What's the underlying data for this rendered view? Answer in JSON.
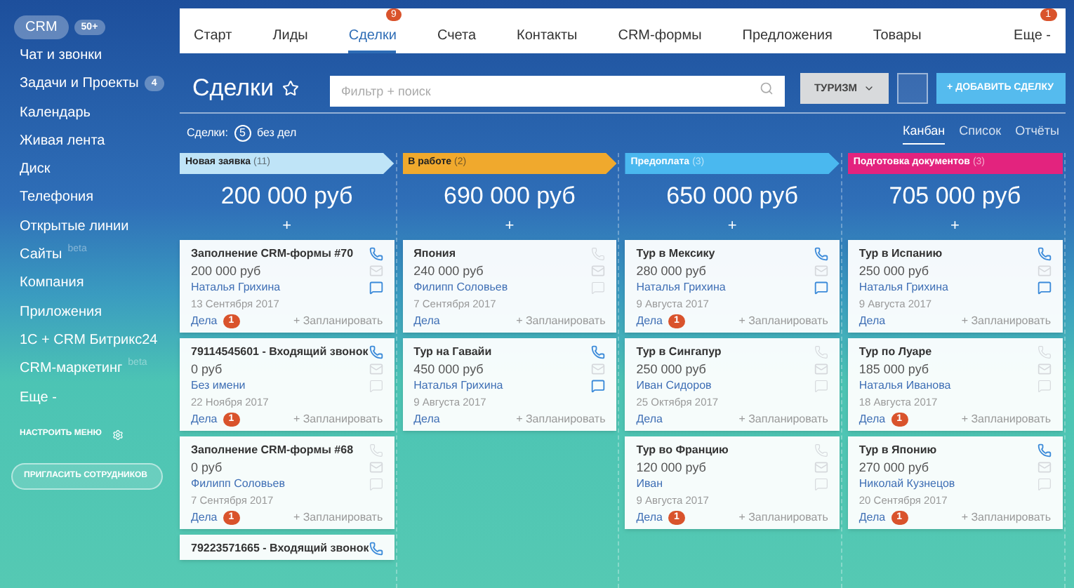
{
  "sidebar": {
    "items": [
      {
        "label": "CRM",
        "selected": true,
        "badge": "50+"
      },
      {
        "label": "Чат и звонки",
        "selected": false
      },
      {
        "label": "Задачи и Проекты",
        "selected": false,
        "badge": "4"
      },
      {
        "label": "Календарь",
        "selected": false
      },
      {
        "label": "Живая лента",
        "selected": false
      },
      {
        "label": "Диск",
        "selected": false
      },
      {
        "label": "Телефония",
        "selected": false
      },
      {
        "label": "Открытые линии",
        "selected": false
      },
      {
        "label": "Сайты",
        "selected": false,
        "tag": "beta"
      },
      {
        "label": "Компания",
        "selected": false
      },
      {
        "label": "Приложения",
        "selected": false
      },
      {
        "label": "1С + CRM Битрикс24",
        "selected": false
      },
      {
        "label": "CRM-маркетинг",
        "selected": false,
        "tag": "beta"
      },
      {
        "label": "Еще -",
        "selected": false
      }
    ],
    "settings": "НАСТРОИТЬ МЕНЮ",
    "invite": "ПРИГЛАСИТЬ СОТРУДНИКОВ"
  },
  "tabs": [
    {
      "label": "Старт",
      "selected": false
    },
    {
      "label": "Лиды",
      "selected": false
    },
    {
      "label": "Сделки",
      "selected": true,
      "badge": "9"
    },
    {
      "label": "Счета",
      "selected": false
    },
    {
      "label": "Контакты",
      "selected": false
    },
    {
      "label": "CRM-формы",
      "selected": false
    },
    {
      "label": "Предложения",
      "selected": false
    },
    {
      "label": "Товары",
      "selected": false
    },
    {
      "label": "Еще -",
      "selected": false,
      "badge": "1"
    }
  ],
  "page": {
    "title": "Сделки",
    "search": {
      "placeholder": "Фильтр + поиск"
    },
    "category": "ТУРИЗМ",
    "add_button": "+ ДОБАВИТЬ СДЕЛКУ"
  },
  "summary": {
    "label": "Сделки:",
    "count": "5",
    "suffix": "без дел"
  },
  "views": [
    {
      "label": "Канбан",
      "selected": true
    },
    {
      "label": "Список",
      "selected": false
    },
    {
      "label": "Отчёты",
      "selected": false
    }
  ],
  "columns": [
    {
      "title": "Новая заявка",
      "count": "(11)",
      "color": "#bfe4f7",
      "total": "200 000 руб",
      "plus": "+",
      "cards": [
        {
          "title": "Заполнение CRM-формы #70",
          "amount": "200 000 руб",
          "contact": "Наталья Грихина",
          "date": "13 Сентября 2017",
          "tasks": "Дела",
          "tasks_count": "1",
          "plan": "+ Запланировать",
          "phone_active": true,
          "chat_active": true
        },
        {
          "title": "79114545601 - Входящий звонок",
          "amount": "0 руб",
          "contact": "Без имени",
          "date": "22 Ноября 2017",
          "tasks": "Дела",
          "tasks_count": "1",
          "plan": "+ Запланировать",
          "phone_active": true,
          "chat_active": false
        },
        {
          "title": "Заполнение CRM-формы #68",
          "amount": "0 руб",
          "contact": "Филипп Соловьев",
          "date": "7 Сентября 2017",
          "tasks": "Дела",
          "tasks_count": "1",
          "plan": "+ Запланировать",
          "phone_active": false,
          "chat_active": false
        },
        {
          "title": "79223571665 - Входящий звонок",
          "phone_active": true
        }
      ]
    },
    {
      "title": "В работе",
      "count": "(2)",
      "color": "#f0a92d",
      "total": "690 000 руб",
      "plus": "+",
      "cards": [
        {
          "title": "Япония",
          "amount": "240 000 руб",
          "contact": "Филипп Соловьев",
          "date": "7 Сентября 2017",
          "tasks": "Дела",
          "plan": "+ Запланировать",
          "phone_active": false,
          "chat_active": false
        },
        {
          "title": "Тур на Гавайи",
          "amount": "450 000 руб",
          "contact": "Наталья Грихина",
          "date": "9 Августа 2017",
          "tasks": "Дела",
          "plan": "+ Запланировать",
          "phone_active": true,
          "chat_active": true
        }
      ]
    },
    {
      "title": "Предоплата",
      "count": "(3)",
      "color": "#4ab8ef",
      "total": "650 000 руб",
      "plus": "+",
      "cards": [
        {
          "title": "Тур в Мексику",
          "amount": "280 000 руб",
          "contact": "Наталья Грихина",
          "date": "9 Августа 2017",
          "tasks": "Дела",
          "tasks_count": "1",
          "plan": "+ Запланировать",
          "phone_active": true,
          "chat_active": true
        },
        {
          "title": "Тур в Сингапур",
          "amount": "250 000 руб",
          "contact": "Иван Сидоров",
          "date": "25 Октября 2017",
          "tasks": "Дела",
          "plan": "+ Запланировать",
          "phone_active": false,
          "chat_active": false
        },
        {
          "title": "Тур во Францию",
          "amount": "120 000 руб",
          "contact": "Иван",
          "date": "9 Августа 2017",
          "tasks": "Дела",
          "tasks_count": "1",
          "plan": "+ Запланировать",
          "phone_active": false,
          "chat_active": false
        }
      ]
    },
    {
      "title": "Подготовка документов",
      "count": "(3)",
      "color": "#e3237e",
      "total": "705 000 руб",
      "plus": "+",
      "cards": [
        {
          "title": "Тур в Испанию",
          "amount": "250 000 руб",
          "contact": "Наталья Грихина",
          "date": "9 Августа 2017",
          "tasks": "Дела",
          "plan": "+ Запланировать",
          "phone_active": true,
          "chat_active": true
        },
        {
          "title": "Тур по Луаре",
          "amount": "185 000 руб",
          "contact": "Наталья Иванова",
          "date": "18 Августа 2017",
          "tasks": "Дела",
          "tasks_count": "1",
          "plan": "+ Запланировать",
          "phone_active": false,
          "chat_active": false
        },
        {
          "title": "Тур в Японию",
          "amount": "270 000 руб",
          "contact": "Николай Кузнецов",
          "date": "20 Сентября 2017",
          "tasks": "Дела",
          "tasks_count": "1",
          "plan": "+ Запланировать",
          "phone_active": true,
          "chat_active": false
        }
      ]
    }
  ]
}
